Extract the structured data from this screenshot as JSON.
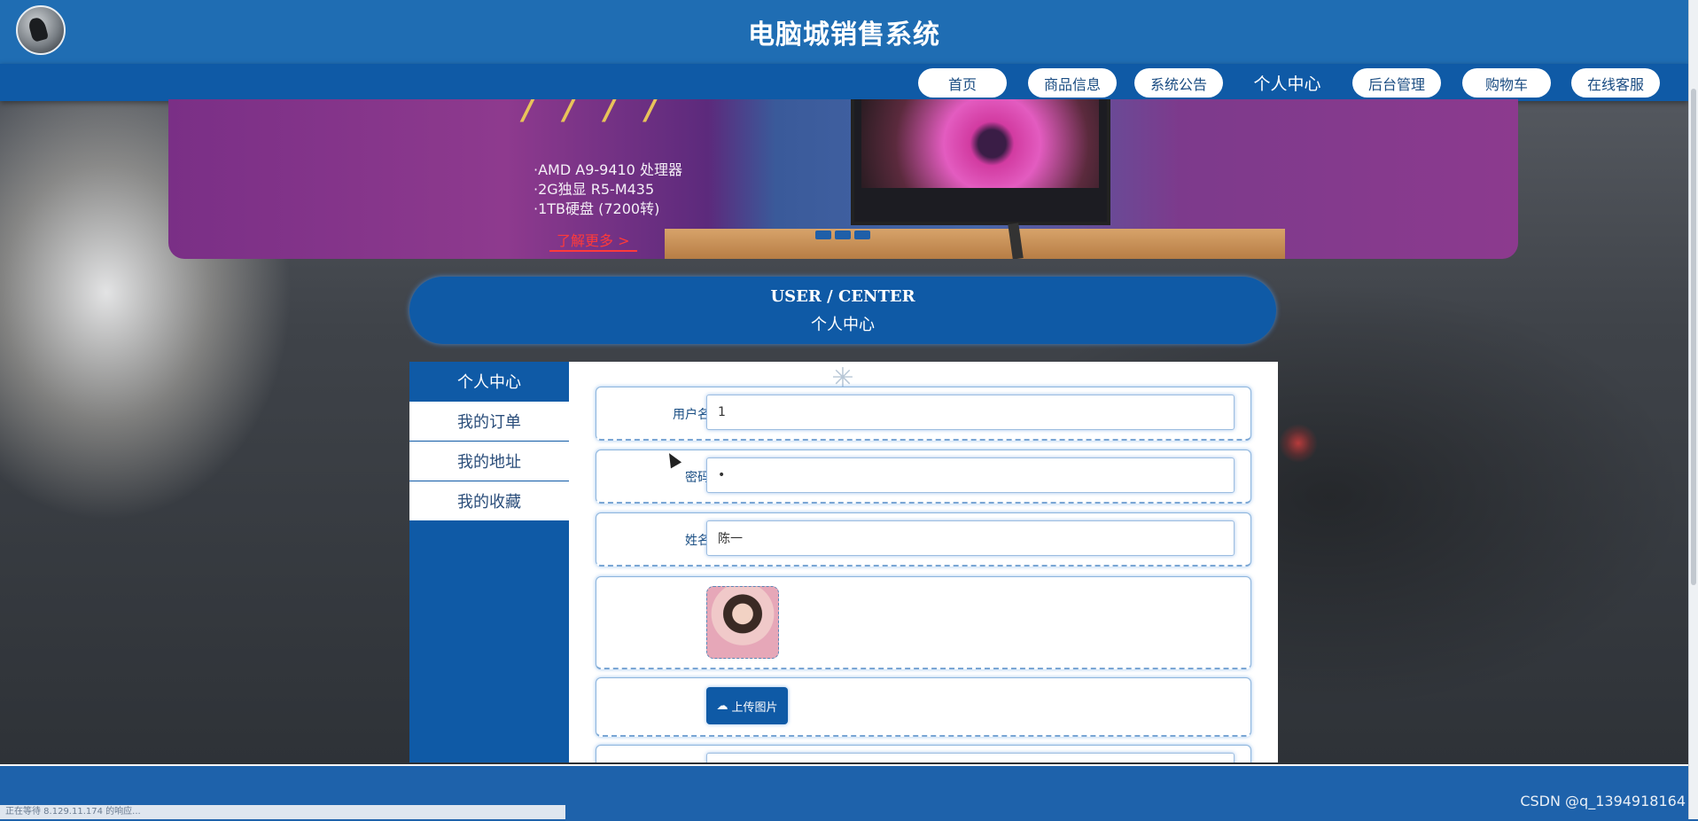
{
  "header": {
    "title": "电脑城销售系统"
  },
  "nav": {
    "items": [
      {
        "label": "首页"
      },
      {
        "label": "商品信息"
      },
      {
        "label": "系统公告"
      },
      {
        "label": "个人中心"
      },
      {
        "label": "后台管理"
      },
      {
        "label": "购物车"
      },
      {
        "label": "在线客服"
      }
    ],
    "active_index": 3
  },
  "banner": {
    "specs": [
      "·AMD A9-9410 处理器",
      "·2G独显 R5-M435",
      "·1TB硬盘 (7200转)"
    ],
    "more_label": "了解更多 >",
    "slide_count": 3
  },
  "user_center": {
    "title_en": "USER / CENTER",
    "title_cn": "个人中心"
  },
  "sidebar": {
    "items": [
      {
        "label": "个人中心"
      },
      {
        "label": "我的订单"
      },
      {
        "label": "我的地址"
      },
      {
        "label": "我的收藏"
      }
    ]
  },
  "form": {
    "username_label": "用户名",
    "username_value": "1",
    "password_label": "密码",
    "password_value": "•",
    "name_label": "姓名",
    "name_value": "陈一",
    "upload_label": "上传图片"
  },
  "status_bar": {
    "text": "正在等待 8.129.11.174 的响应..."
  },
  "watermark": {
    "text": "CSDN @q_1394918164"
  },
  "colors": {
    "primary": "#1f6db3",
    "nav": "#0f5aa6",
    "accent": "#ff3a3a"
  }
}
